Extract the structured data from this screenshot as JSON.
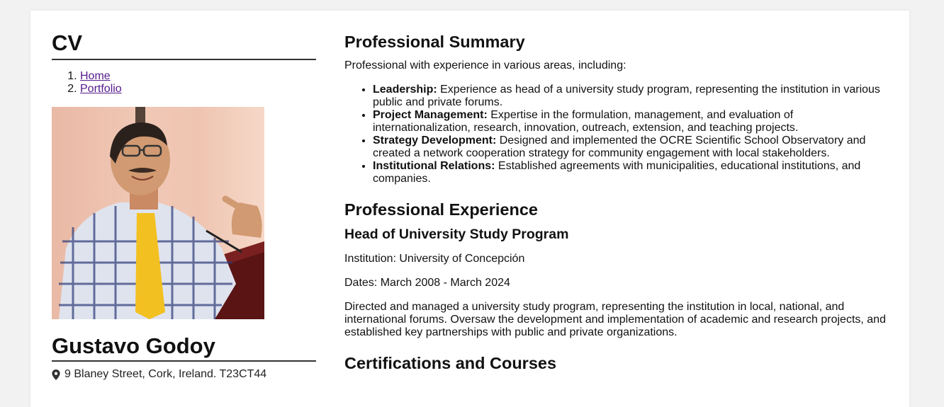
{
  "sidebar": {
    "cv_title": "CV",
    "nav": [
      {
        "num": "1.",
        "label": "Home"
      },
      {
        "num": "2.",
        "label": "Portfolio"
      }
    ],
    "name": "Gustavo Godoy",
    "address": "9 Blaney Street, Cork, Ireland. T23CT44",
    "address_icon": "location-pin-icon"
  },
  "summary": {
    "heading": "Professional Summary",
    "intro": "Professional with experience in various areas, including:",
    "items": [
      {
        "title": "Leadership:",
        "text": " Experience as head of a university study program, representing the institution in various public and private forums."
      },
      {
        "title": "Project Management:",
        "text": " Expertise in the formulation, management, and evaluation of internationalization, research, innovation, outreach, extension, and teaching projects."
      },
      {
        "title": "Strategy Development:",
        "text": " Designed and implemented the OCRE Scientific School Observatory and created a network cooperation strategy for community engagement with local stakeholders."
      },
      {
        "title": "Institutional Relations:",
        "text": " Established agreements with municipalities, educational institutions, and companies."
      }
    ]
  },
  "experience": {
    "heading": "Professional Experience",
    "job_title": "Head of University Study Program",
    "institution": "Institution: University of Concepción",
    "dates": "Dates: March 2008 - March 2024",
    "description": "Directed and managed a university study program, representing the institution in local, national, and international forums. Oversaw the development and implementation of academic and research projects, and established key partnerships with public and private organizations."
  },
  "certifications": {
    "heading": "Certifications and Courses"
  },
  "colors": {
    "page_bg": "#f2f2f2",
    "card_bg": "#ffffff",
    "visited_link": "#551a8b",
    "tie": "#f2c021"
  }
}
